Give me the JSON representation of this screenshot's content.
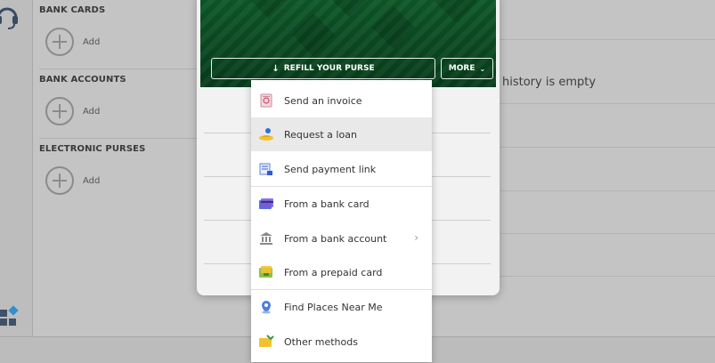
{
  "sections": [
    {
      "title": "BANK CARDS",
      "add_label": "Add"
    },
    {
      "title": "BANK ACCOUNTS",
      "add_label": "Add"
    },
    {
      "title": "ELECTRONIC PURSES",
      "add_label": "Add"
    }
  ],
  "history_text": "history is empty",
  "buttons": {
    "refill": "REFILL YOUR PURSE",
    "more": "MORE"
  },
  "menu": [
    {
      "label": "Send an invoice",
      "icon": "invoice-icon"
    },
    {
      "label": "Request a loan",
      "icon": "loan-icon",
      "active": true
    },
    {
      "label": "Send payment link",
      "icon": "payment-link-icon"
    },
    {
      "label": "From a bank card",
      "icon": "bank-card-icon"
    },
    {
      "label": "From a bank account",
      "icon": "bank-icon",
      "has_submenu": true
    },
    {
      "label": "From a prepaid card",
      "icon": "prepaid-card-icon"
    },
    {
      "label": "Find Places Near Me",
      "icon": "map-pin-icon"
    },
    {
      "label": "Other methods",
      "icon": "other-methods-icon"
    }
  ],
  "colors": {
    "banner": "#0b4a22",
    "overlay": "#c4c4c4",
    "menu_active": "#e9e9e9"
  }
}
